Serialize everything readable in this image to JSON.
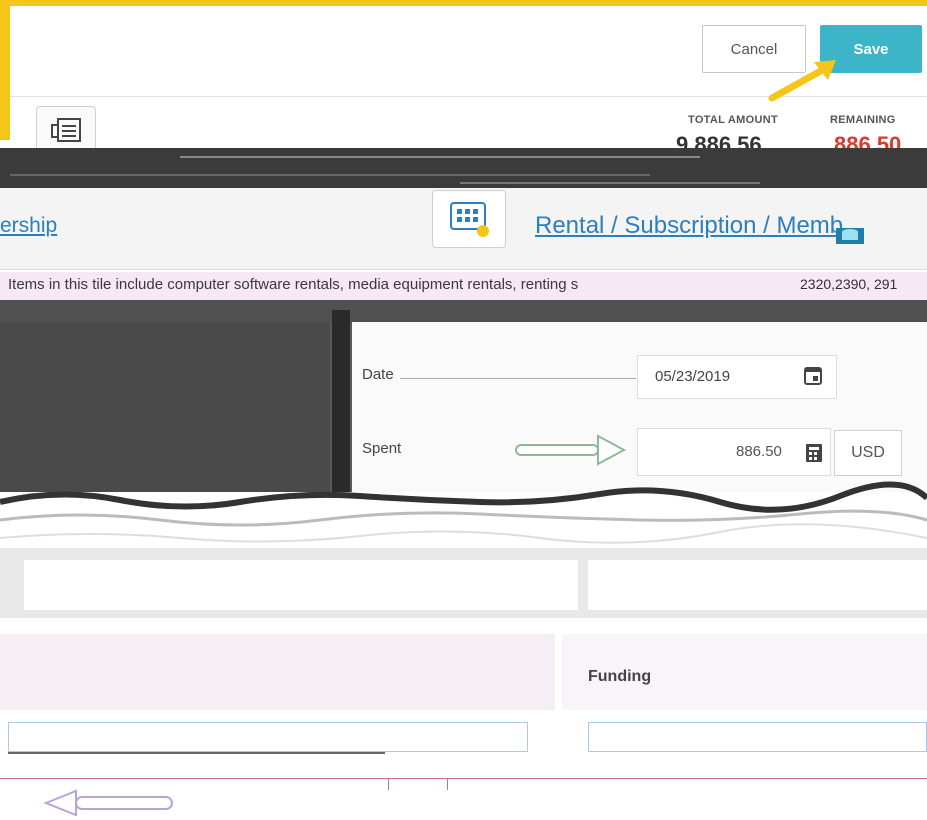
{
  "header": {
    "cancel_label": "Cancel",
    "save_label": "Save",
    "total_amount_label": "TOTAL AMOUNT",
    "remaining_label": "REMAINING",
    "total_amount_value": "9,886.56",
    "remaining_value": "886.50"
  },
  "category": {
    "left_fragment": "ership",
    "title": "Rental / Subscription / Memb",
    "description": "Items in this tile include computer software rentals, media equipment rentals, renting s",
    "codes": "2320,2390, 291"
  },
  "details": {
    "date_label": "Date",
    "date_value": "05/23/2019",
    "spent_label": "Spent",
    "spent_value": "886.50",
    "currency_label": "USD"
  },
  "funding": {
    "label": "Funding"
  },
  "colors": {
    "save_bg": "#3cb5c9",
    "remaining_red": "#d83a2e",
    "link_blue": "#2a7fc1",
    "annotation_yellow": "#f5c518"
  },
  "icons": [
    "document-icon",
    "grid-icon",
    "calendar-icon",
    "calculator-icon",
    "arrow-icon"
  ]
}
